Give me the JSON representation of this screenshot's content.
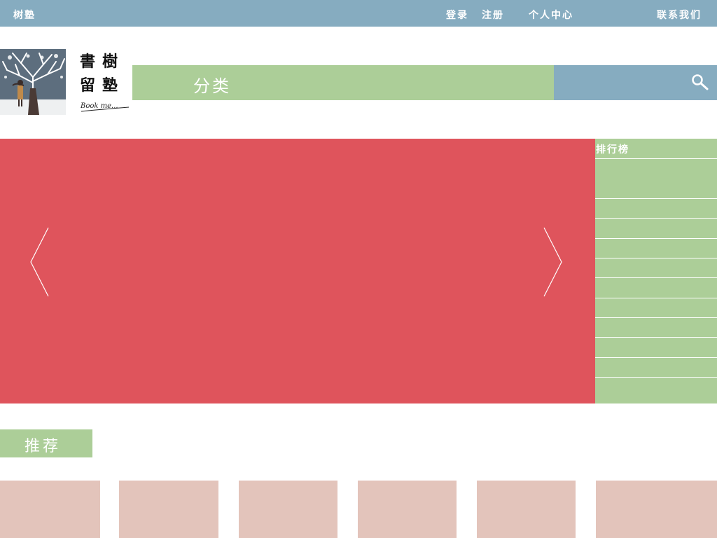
{
  "topbar": {
    "brand": "树塾",
    "login": "登录",
    "register": "注册",
    "profile": "个人中心",
    "contact": "联系我们"
  },
  "logo": {
    "glyphs": [
      "書",
      "樹",
      "留",
      "塾"
    ],
    "signature": "Book me...",
    "icon": "tree-illustration-icon"
  },
  "category": {
    "label": "分类"
  },
  "search": {
    "value": "",
    "icon": "search-icon"
  },
  "banner": {
    "color": "#df545c",
    "prev_icon": "chevron-left-icon",
    "next_icon": "chevron-right-icon"
  },
  "ranking": {
    "title": "排行榜",
    "rows": [
      "",
      "",
      "",
      "",
      "",
      "",
      "",
      "",
      "",
      ""
    ]
  },
  "recommend": {
    "label": "推荐",
    "cards": [
      "",
      "",
      "",
      "",
      "",
      ""
    ]
  },
  "colors": {
    "topbar": "#86acc0",
    "green": "#acce98",
    "red": "#df545c",
    "card": "#e3c4bb"
  }
}
